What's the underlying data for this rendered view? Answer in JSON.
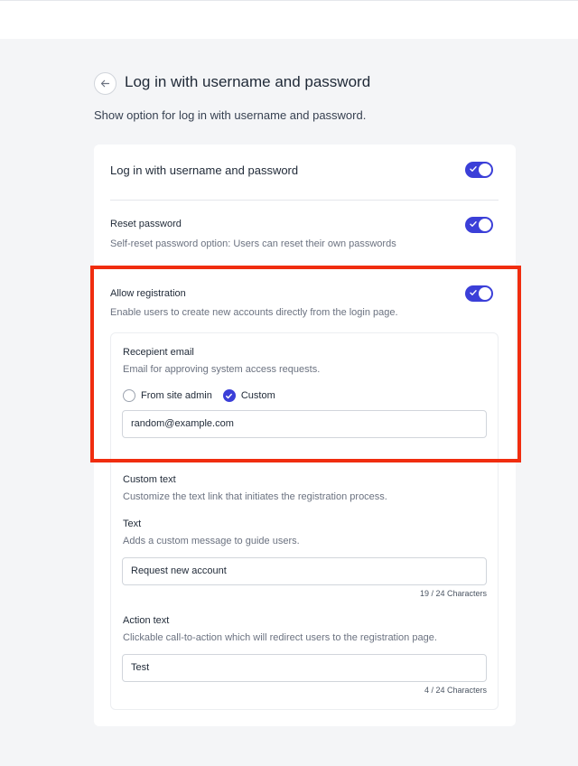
{
  "header": {
    "title": "Log in with username and password",
    "subtitle": "Show option for log in with username and password."
  },
  "settings": {
    "login": {
      "label": "Log in with username and password",
      "enabled": true
    },
    "reset_password": {
      "label": "Reset password",
      "description": "Self-reset password option: Users can reset their own passwords",
      "enabled": true
    },
    "allow_registration": {
      "label": "Allow registration",
      "description": "Enable users to create new accounts directly from the login page.",
      "enabled": true
    }
  },
  "registration": {
    "recipient": {
      "label": "Recepient email",
      "description": "Email for approving system access requests.",
      "options": [
        "From site admin",
        "Custom"
      ],
      "selected": "Custom",
      "email_value": "random@example.com"
    },
    "custom_text": {
      "label": "Custom text",
      "description": "Customize the text link that initiates the registration process."
    },
    "text": {
      "label": "Text",
      "description": "Adds a custom message to guide users.",
      "value": "Request new account",
      "counter": "19 / 24 Characters"
    },
    "action_text": {
      "label": "Action text",
      "description": "Clickable call-to-action which will redirect users to the registration page.",
      "value": "Test",
      "counter": "4 / 24 Characters"
    }
  },
  "colors": {
    "accent": "#3b3fd8",
    "highlight": "#f02d0f"
  },
  "icons": {
    "back": "arrow-left-icon",
    "toggle_check": "check-icon",
    "radio_check": "check-icon"
  }
}
